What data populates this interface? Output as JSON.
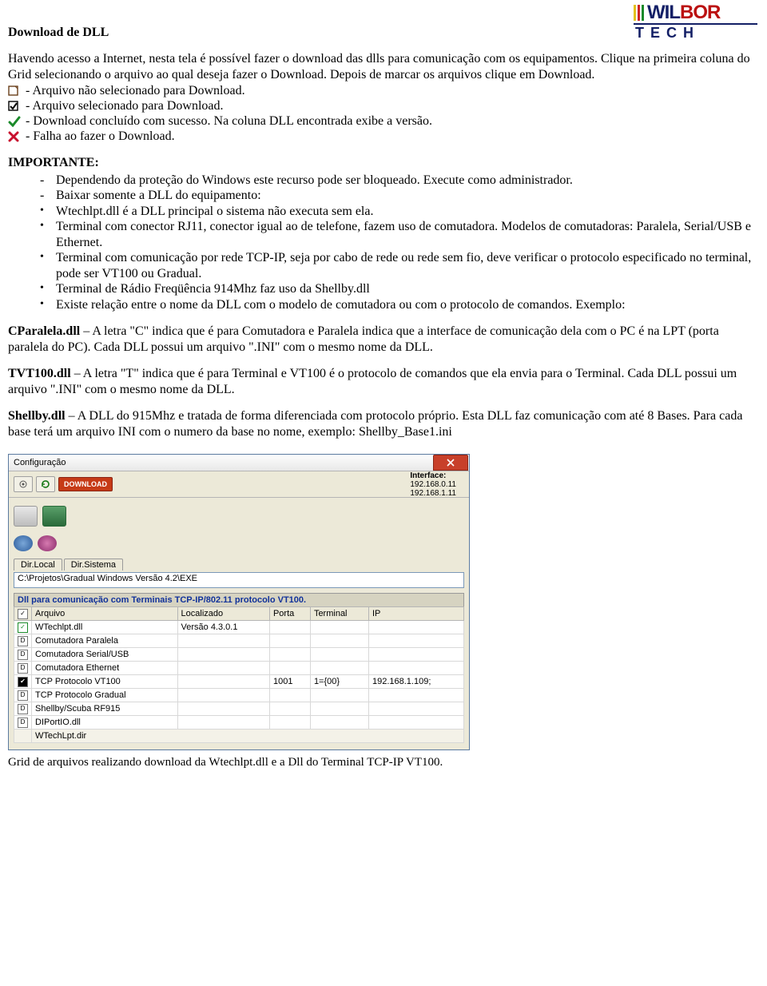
{
  "logo": {
    "brand_left": "WIL",
    "brand_right": "BOR",
    "sub": "TECH"
  },
  "title": "Download de DLL",
  "intro": {
    "p1": "Havendo acesso a Internet, nesta tela é possível fazer o download das dlls para comunicação com os equipamentos. Clique na primeira coluna do Grid selecionando o arquivo ao qual deseja fazer o Download.  Depois de marcar os arquivos clique em Download."
  },
  "icon_lines": {
    "unselected": " - Arquivo não selecionado para Download.",
    "selected": " - Arquivo selecionado para Download.",
    "success": " - Download concluído com sucesso. Na coluna DLL encontrada exibe a versão.",
    "fail": " - Falha ao fazer o Download."
  },
  "importante": {
    "head": "IMPORTANTE:",
    "d1": "Dependendo da proteção do Windows este recurso pode ser bloqueado. Execute como administrador.",
    "d2": "Baixar somente a DLL do equipamento:",
    "b1": "Wtechlpt.dll é a DLL principal o sistema não executa sem ela.",
    "b2": "Terminal com conector RJ11, conector igual ao de telefone, fazem uso de comutadora.  Modelos de comutadoras: Paralela, Serial/USB e Ethernet.",
    "b3": "Terminal com comunicação por rede TCP-IP, seja por cabo de rede ou rede sem fio, deve verificar o protocolo especificado no terminal, pode ser VT100 ou Gradual.",
    "b4": "Terminal de Rádio Freqüência 914Mhz faz uso da Shellby.dll",
    "b5": "Existe relação entre o nome da DLL com o modelo de comutadora ou com o protocolo de comandos. Exemplo:"
  },
  "paras": {
    "cp_bold": "CParalela.dll",
    "cp_rest": " – A letra \"C\" indica que é para Comutadora e Paralela indica que a interface de comunicação dela com o PC é na LPT (porta paralela do PC).  Cada DLL possui um arquivo \".INI\" com o mesmo nome da DLL.",
    "tv_bold": "TVT100.dll",
    "tv_rest": " – A letra \"T\" indica que é para Terminal e VT100 é o protocolo de comandos que ela envia para o Terminal.  Cada DLL possui um arquivo \".INI\" com o mesmo nome da DLL.",
    "sh_bold": "Shellby.dll",
    "sh_rest": " – A DLL do 915Mhz e tratada de forma diferenciada com protocolo próprio.  Esta DLL faz comunicação com até 8 Bases.  Para cada base terá um arquivo INI com o numero da base no nome, exemplo: Shellby_Base1.ini"
  },
  "window": {
    "title": "Configuração",
    "download_btn": "DOWNLOAD",
    "interface_label": "Interface:",
    "ip1": "192.168.0.11",
    "ip2": "192.168.1.11",
    "tab1": "Dir.Local",
    "tab2": "Dir.Sistema",
    "path": "C:\\Projetos\\Gradual Windows Versão 4.2\\EXE",
    "blue_header": "Dll para comunicação com Terminais TCP-IP/802.11 protocolo VT100.",
    "cols": {
      "c1": "Arquivo",
      "c2": "Localizado",
      "c3": "Porta",
      "c4": "Terminal",
      "c5": "IP"
    },
    "rows": [
      {
        "icon": "check",
        "arquivo": "WTechlpt.dll",
        "loc": "Versão 4.3.0.1",
        "porta": "",
        "term": "",
        "ip": ""
      },
      {
        "icon": "D",
        "arquivo": "Comutadora Paralela",
        "loc": "",
        "porta": "",
        "term": "",
        "ip": ""
      },
      {
        "icon": "D",
        "arquivo": "Comutadora Serial/USB",
        "loc": "",
        "porta": "",
        "term": "",
        "ip": ""
      },
      {
        "icon": "D",
        "arquivo": "Comutadora Ethernet",
        "loc": "",
        "porta": "",
        "term": "",
        "ip": ""
      },
      {
        "icon": "sel",
        "arquivo": "TCP Protocolo VT100",
        "loc": "",
        "porta": "1001",
        "term": "1={00}",
        "ip": "192.168.1.109;"
      },
      {
        "icon": "D",
        "arquivo": "TCP Protocolo Gradual",
        "loc": "",
        "porta": "",
        "term": "",
        "ip": ""
      },
      {
        "icon": "D",
        "arquivo": "Shellby/Scuba RF915",
        "loc": "",
        "porta": "",
        "term": "",
        "ip": ""
      },
      {
        "icon": "D",
        "arquivo": "DIPortIO.dll",
        "loc": "",
        "porta": "",
        "term": "",
        "ip": ""
      }
    ],
    "footer_row": "WTechLpt.dir"
  },
  "caption": "Grid de arquivos realizando download da Wtechlpt.dll e a Dll do Terminal TCP-IP VT100."
}
